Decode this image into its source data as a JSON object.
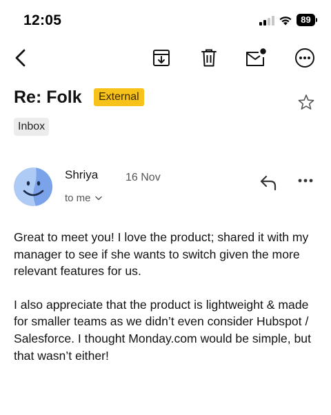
{
  "status_bar": {
    "time": "12:05",
    "battery": "89",
    "icons": [
      "signal-icon",
      "wifi-icon",
      "battery-icon"
    ]
  },
  "toolbar": {
    "icons": [
      "back-chevron-icon",
      "archive-icon",
      "trash-icon",
      "mark-unread-icon",
      "more-options-icon"
    ]
  },
  "email": {
    "subject": "Re: Folk",
    "badge": "External",
    "label": "Inbox",
    "sender": "Shriya",
    "date": "16 Nov",
    "recipient": "to me",
    "body": [
      "Great to meet you! I love the product; shared it with my manager to see if she wants to switch given the more relevant features for us.",
      "I also appreciate that the product is lightweight & made for smaller teams as we didn’t even consider Hubspot / Salesforce. I thought Monday.com would be simple, but that wasn’t either!"
    ]
  },
  "colors": {
    "badge": "#f7c21a",
    "avatar_light": "#aecbf5",
    "avatar_dark": "#7aa3ea",
    "chip": "#ececec"
  }
}
